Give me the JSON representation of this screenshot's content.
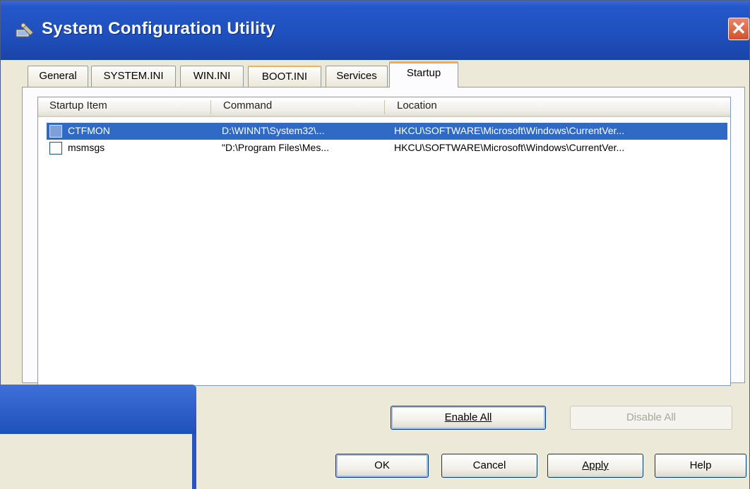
{
  "window": {
    "title": "System Configuration Utility",
    "close_symbol": "✕"
  },
  "tabs": [
    {
      "label": "General"
    },
    {
      "label": "SYSTEM.INI"
    },
    {
      "label": "WIN.INI"
    },
    {
      "label": "BOOT.INI"
    },
    {
      "label": "Services"
    },
    {
      "label": "Startup"
    }
  ],
  "active_tab": "Startup",
  "list": {
    "columns": [
      "Startup Item",
      "Command",
      "Location"
    ],
    "rows": [
      {
        "item": "CTFMON",
        "command": "D:\\WINNT\\System32\\...",
        "location": "HKCU\\SOFTWARE\\Microsoft\\Windows\\CurrentVer...",
        "checked": true,
        "selected": true
      },
      {
        "item": "msmsgs",
        "command": "\"D:\\Program Files\\Mes...",
        "location": "HKCU\\SOFTWARE\\Microsoft\\Windows\\CurrentVer...",
        "checked": false,
        "selected": false
      }
    ]
  },
  "actions": {
    "enable_all": "Enable All",
    "disable_all": "Disable All"
  },
  "dialog_buttons": {
    "ok": "OK",
    "cancel": "Cancel",
    "apply": "Apply",
    "help": "Help"
  },
  "colors": {
    "titlebar": "#2457c9",
    "selection": "#316ac5",
    "active_tab_highlight": "#f5a94a",
    "close_button": "#d3502c"
  },
  "icons": {
    "app": "msconfig-wrench-icon",
    "close": "close-icon"
  }
}
